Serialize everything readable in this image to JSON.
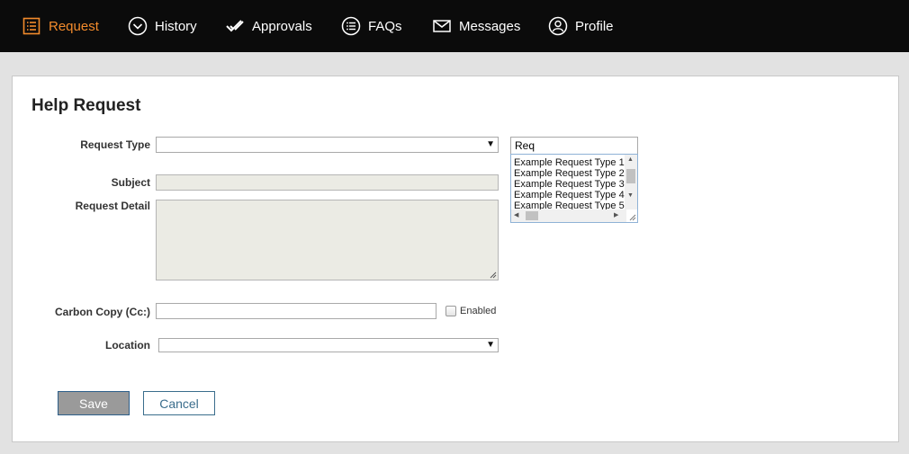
{
  "nav": {
    "items": [
      {
        "label": "Request",
        "icon": "list-icon",
        "active": true
      },
      {
        "label": "History",
        "icon": "chevron-circle-icon",
        "active": false
      },
      {
        "label": "Approvals",
        "icon": "double-check-icon",
        "active": false
      },
      {
        "label": "FAQs",
        "icon": "list-circle-icon",
        "active": false
      },
      {
        "label": "Messages",
        "icon": "envelope-icon",
        "active": false
      },
      {
        "label": "Profile",
        "icon": "user-circle-icon",
        "active": false
      }
    ],
    "active_color": "#f38b2c"
  },
  "form": {
    "title": "Help Request",
    "request_type_label": "Request Type",
    "request_type_value": "",
    "request_search_value": "Req",
    "request_type_options": [
      "Example Request Type 1",
      "Example Request Type 2",
      "Example Request Type 3",
      "Example Request Type 4",
      "Example Request Type 5"
    ],
    "subject_label": "Subject",
    "request_detail_label": "Request Detail",
    "cc_label": "Carbon Copy (Cc:)",
    "cc_value": "",
    "enabled_label": "Enabled",
    "enabled_checked": false,
    "location_label": "Location",
    "location_value": "",
    "save_label": "Save",
    "cancel_label": "Cancel"
  }
}
